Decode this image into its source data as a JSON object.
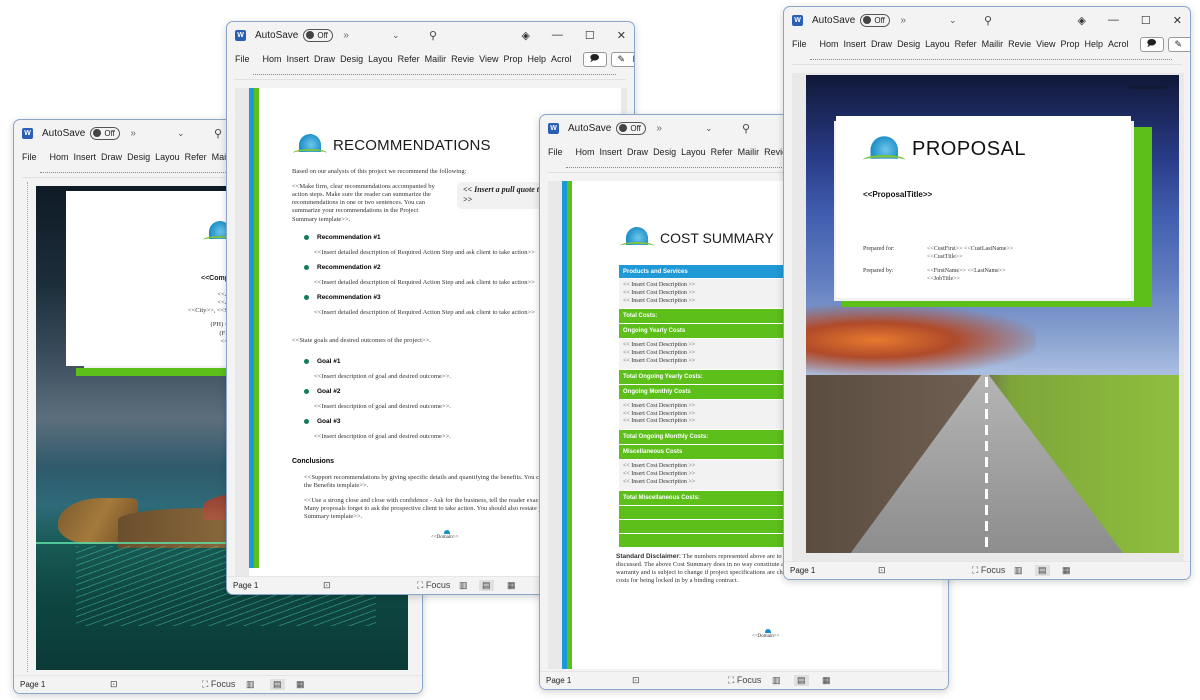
{
  "app": {
    "autosave_label": "AutoSave",
    "autosave_state": "Off",
    "more_glyph": "»",
    "dropdown_glyph": "⌄",
    "search_glyph": "⚲",
    "diamond_glyph": "◈",
    "minimize_glyph": "—",
    "maximize_glyph": "☐",
    "close_glyph": "✕",
    "word_icon_letter": "W",
    "ribbon_tabs": [
      "File",
      "Hom",
      "Insert",
      "Draw",
      "Desig",
      "Layou",
      "Refer",
      "Mailir",
      "Revie",
      "View",
      "Prop",
      "Help",
      "Acrol"
    ],
    "comment_glyph": "🗩",
    "editing_label": "Editing",
    "editing_glyph": "✎",
    "ribbon_scroll_glyph": "›",
    "status": {
      "page_label": "Page 1",
      "focus_label": "Focus",
      "accessibility_glyph": "⊡",
      "focus_glyph": "⛶",
      "read_mode_glyph": "▥",
      "print_layout_glyph": "▤",
      "web_layout_glyph": "▦"
    }
  },
  "colors": {
    "accent_green": "#5cbf1a",
    "accent_blue": "#1a9ad6",
    "window_border": "#8aa6c8"
  },
  "windows": {
    "cover": {
      "company_placeholder": "<<Comp",
      "address_lines": [
        "<<Addre",
        "<<Addre",
        "<<City>>, <<State>"
      ],
      "phone_lines": [
        "(PH) <<Wo",
        "(FX) <<",
        "<<Dom"
      ]
    },
    "recommendations": {
      "title": "RECOMMENDATIONS",
      "intro": "Based on our analysis of this project we recommend the following:",
      "guidance": "<<Make firm, clear recommendations accompanied by action steps.  Make sure the reader can summarize the recommendations in one or two sentences.  You can summarize your recommendations in the Project Summary template>>.",
      "pull_quote": "<< Insert a pull quote that will be in emphasis text >>",
      "recommendations": [
        {
          "heading": "Recommendation #1",
          "text": "<<Insert detailed description of Required Action Step and ask client to take action>>"
        },
        {
          "heading": "Recommendation #2",
          "text": "<<Insert detailed description of Required Action Step and ask client to take action>>"
        },
        {
          "heading": "Recommendation #3",
          "text": "<<Insert detailed description of Required Action Step and ask client to take action>>"
        }
      ],
      "goals_intro": "<<State goals and desired outcomes of the project>>.",
      "goals": [
        {
          "heading": "Goal #1",
          "text": "<<Insert description of goal and desired outcome>>."
        },
        {
          "heading": "Goal #2",
          "text": "<<Insert description of goal and desired outcome>>."
        },
        {
          "heading": "Goal #3",
          "text": "<<Insert description of goal and desired outcome>>."
        }
      ],
      "conclusions_heading": "Conclusions",
      "conclusion_1": "<<Support recommendations by giving specific details and quantifying the benefits.  You can expand on the benefits by adding the Benefits template>>.",
      "conclusion_2": "<<Use a strong close and close with confidence - Ask for the business, tell the reader exactly what you want him or her to do.  Many proposals forget to ask the prospective client to take action. You should also restate your request for action in the Project Summary template>>.",
      "footer_domain": "<<Domain>>"
    },
    "cost_summary": {
      "title": "COST SUMMARY",
      "sections": [
        {
          "header": "Products and Services",
          "style": "blue",
          "items": [
            "<< Insert Cost Description >>",
            "<< Insert Cost Description >>",
            "<< Insert Cost Description >>"
          ],
          "total": "Total Costs:"
        },
        {
          "header": "Ongoing Yearly Costs",
          "style": "green",
          "items": [
            "<< Insert Cost Description >>",
            "<< Insert Cost Description >>",
            "<< Insert Cost Description >>"
          ],
          "total": "Total Ongoing Yearly Costs:"
        },
        {
          "header": "Ongoing Monthly Costs",
          "style": "green",
          "items": [
            "<< Insert Cost Description >>",
            "<< Insert Cost Description >>",
            "<< Insert Cost Description >>"
          ],
          "total": "Total Ongoing Monthly Costs:"
        },
        {
          "header": "Miscellaneous Costs",
          "style": "green",
          "items": [
            "<< Insert Cost Description >>",
            "<< Insert Cost Description >>",
            "<< Insert Cost Description >>"
          ],
          "total": "Total Miscellaneous Costs:"
        }
      ],
      "disclaimer_label": "Standard Disclaimer:",
      "disclaimer_text": "The numbers represented above are to be discussed. The above Cost Summary does in no way constitute a warranty and is subject to change if project specifications are changed or costs for being locked in by a binding contract.",
      "footer_domain": "<<Domain>>"
    },
    "proposal": {
      "current_date": "<<CurrentDate>>",
      "title": "PROPOSAL",
      "proposal_title": "<<ProposalTitle>>",
      "prepared_for_label": "Prepared for:",
      "prepared_for_line1": "<<CustFirst>> <<CustLastName>>",
      "prepared_for_line2": "<<CustTitle>>",
      "prepared_by_label": "Prepared by:",
      "prepared_by_line1": "<<FirstName>> <<LastName>>",
      "prepared_by_line2": "<<JobTitle>>"
    }
  }
}
